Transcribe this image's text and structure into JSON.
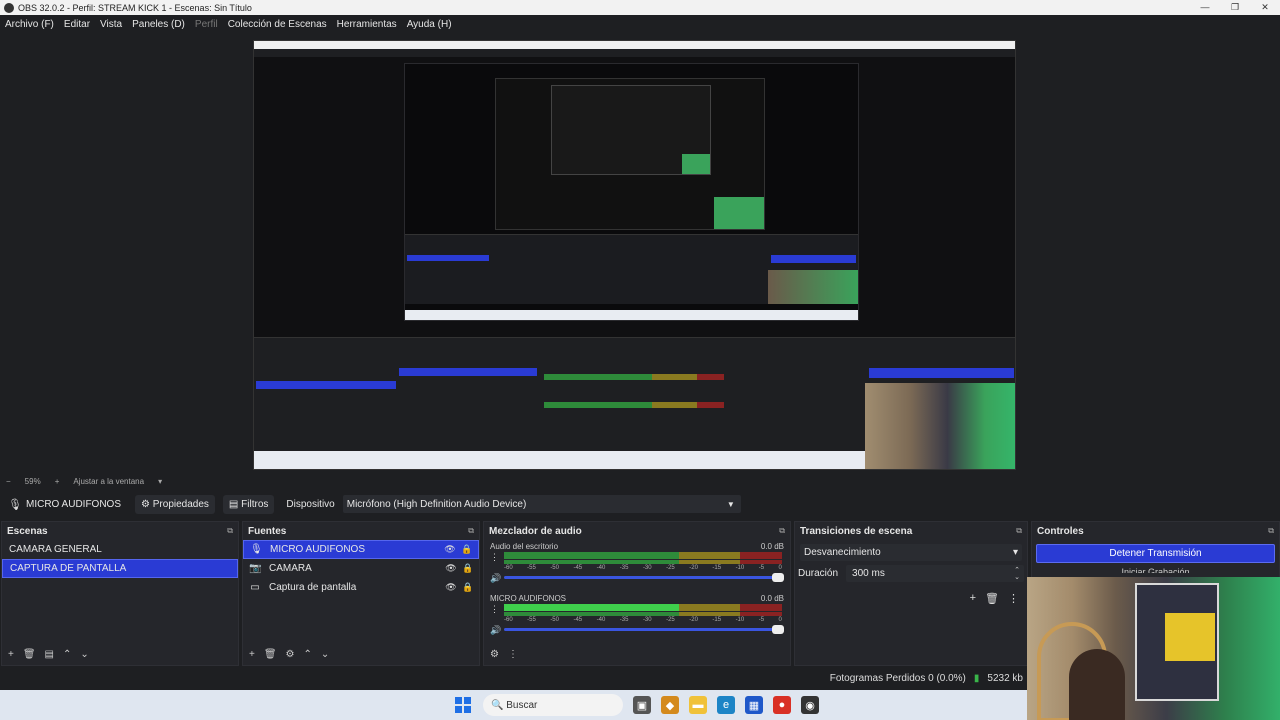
{
  "window": {
    "title": "OBS 32.0.2 - Perfil: STREAM KICK 1 - Escenas: Sin Título",
    "controls": [
      "—",
      "❐",
      "✕"
    ]
  },
  "menu": [
    {
      "label": "Archivo (F)"
    },
    {
      "label": "Editar"
    },
    {
      "label": "Vista"
    },
    {
      "label": "Paneles (D)"
    },
    {
      "label": "Perfil"
    },
    {
      "label": "Colección de Escenas"
    },
    {
      "label": "Herramientas"
    },
    {
      "label": "Ayuda (H)"
    }
  ],
  "zoom": {
    "percent": "59%",
    "fit_label": "Ajustar a la ventana"
  },
  "source_toolbar": {
    "source_name": "MICRO AUDIFONOS",
    "properties_label": "Propiedades",
    "filters_label": "Filtros",
    "device_label": "Dispositivo",
    "device_value": "Micrófono (High Definition Audio Device)"
  },
  "scenes": {
    "title": "Escenas",
    "items": [
      {
        "label": "CAMARA GENERAL",
        "selected": false
      },
      {
        "label": "CAPTURA DE PANTALLA",
        "selected": true
      }
    ]
  },
  "sources": {
    "title": "Fuentes",
    "items": [
      {
        "label": "MICRO AUDIFONOS",
        "icon": "microphone-icon",
        "selected": true
      },
      {
        "label": "CAMARA",
        "icon": "camera-icon",
        "selected": false
      },
      {
        "label": "Captura de pantalla",
        "icon": "monitor-icon",
        "selected": false
      }
    ]
  },
  "mixer": {
    "title": "Mezclador de audio",
    "channels": [
      {
        "name": "Audio del escritorio",
        "db": "0.0 dB"
      },
      {
        "name": "MICRO AUDIFONOS",
        "db": "0.0 dB"
      }
    ],
    "ticks": [
      "-60",
      "-55",
      "-50",
      "-45",
      "-40",
      "-35",
      "-30",
      "-25",
      "-20",
      "-15",
      "-10",
      "-5",
      "0"
    ]
  },
  "transitions": {
    "title": "Transiciones de escena",
    "selected": "Desvanecimiento",
    "duration_label": "Duración",
    "duration_value": "300 ms"
  },
  "controls": {
    "title": "Controles",
    "stream_button": "Detener Transmisión",
    "record_button": "Iniciar Grabación"
  },
  "status": {
    "frames_dropped": "Fotogramas Perdidos 0 (0.0%)",
    "bitrate": "5232 kb"
  },
  "taskbar": {
    "search_placeholder": "Buscar"
  },
  "colors": {
    "accent": "#2a3bd4",
    "background": "#1e1f22",
    "dock": "#25262b",
    "meter_green": "#2e8b3a",
    "meter_yellow": "#8a7a20",
    "meter_red": "#8a2222"
  }
}
